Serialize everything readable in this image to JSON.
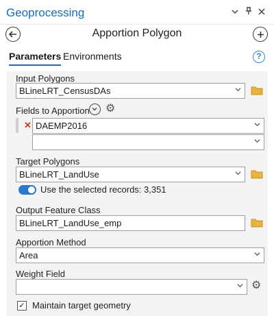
{
  "pane": {
    "title": "Geoprocessing",
    "controls": {
      "menu": "⌄",
      "pin": "ᛘ",
      "close": "✕"
    }
  },
  "tool": {
    "title": "Apportion Polygon",
    "back": "←",
    "add": "+"
  },
  "tabs": [
    {
      "label": "Parameters"
    },
    {
      "label": "Environments"
    }
  ],
  "help": "?",
  "params": {
    "input_polygons": {
      "label": "Input Polygons",
      "value": "BLineLRT_CensusDAs"
    },
    "fields_to_apportion": {
      "label": "Fields to Apportion",
      "rows": [
        {
          "value": "DAEMP2016"
        },
        {
          "value": ""
        }
      ]
    },
    "target_polygons": {
      "label": "Target Polygons",
      "value": "BLineLRT_LandUse",
      "toggle_label": "Use the selected records: 3,351",
      "toggle_on": true
    },
    "output_feature_class": {
      "label": "Output Feature Class",
      "value": "BLineLRT_LandUse_emp"
    },
    "apportion_method": {
      "label": "Apportion Method",
      "value": "Area"
    },
    "weight_field": {
      "label": "Weight Field",
      "value": ""
    },
    "maintain_target_geometry": {
      "label": "Maintain target geometry",
      "checked": true
    }
  }
}
